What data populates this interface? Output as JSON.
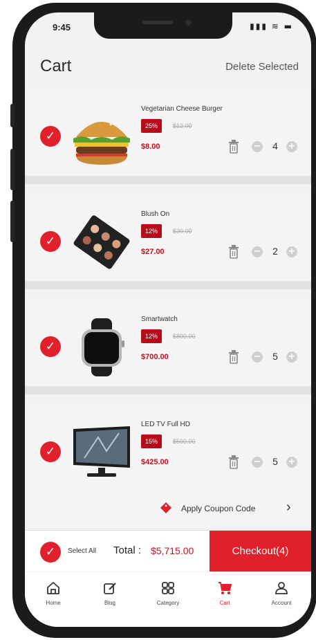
{
  "status": {
    "time": "9:45",
    "icons": "▮▮▮ ≋ ▬"
  },
  "header": {
    "title": "Cart",
    "delete_label": "Delete Selected"
  },
  "check_glyph": "✓",
  "items": [
    {
      "name": "Vegetarian Cheese Burger",
      "discount": "25%",
      "old_price": "$12.00",
      "price": "$8.00",
      "qty": "4",
      "image_icon": "burger-icon"
    },
    {
      "name": "Blush On",
      "discount": "12%",
      "old_price": "$30.00",
      "price": "$27.00",
      "qty": "2",
      "image_icon": "palette-icon"
    },
    {
      "name": "Smartwatch",
      "discount": "12%",
      "old_price": "$800.00",
      "price": "$700.00",
      "qty": "5",
      "image_icon": "watch-icon"
    },
    {
      "name": "LED TV Full HD",
      "discount": "15%",
      "old_price": "$500.00",
      "price": "$425.00",
      "qty": "5",
      "image_icon": "tv-icon"
    }
  ],
  "qty_minus": "−",
  "qty_plus": "+",
  "coupon": {
    "label": "Apply Coupon Code",
    "chevron": "›"
  },
  "footer": {
    "select_all": "Select All",
    "total_label": "Total :",
    "total_value": "$5,715.00",
    "checkout_label": "Checkout(4)"
  },
  "tabs": [
    {
      "label": "Home",
      "icon": "home-icon"
    },
    {
      "label": "Blog",
      "icon": "blog-icon"
    },
    {
      "label": "Category",
      "icon": "category-icon"
    },
    {
      "label": "Cart",
      "icon": "cart-icon",
      "active": true
    },
    {
      "label": "Account",
      "icon": "account-icon"
    }
  ],
  "colors": {
    "accent": "#e0202b",
    "badge": "#b50e1a",
    "price": "#c0121f",
    "bezel": "#1b1b1b",
    "screen_bg": "#f2f2f2"
  }
}
